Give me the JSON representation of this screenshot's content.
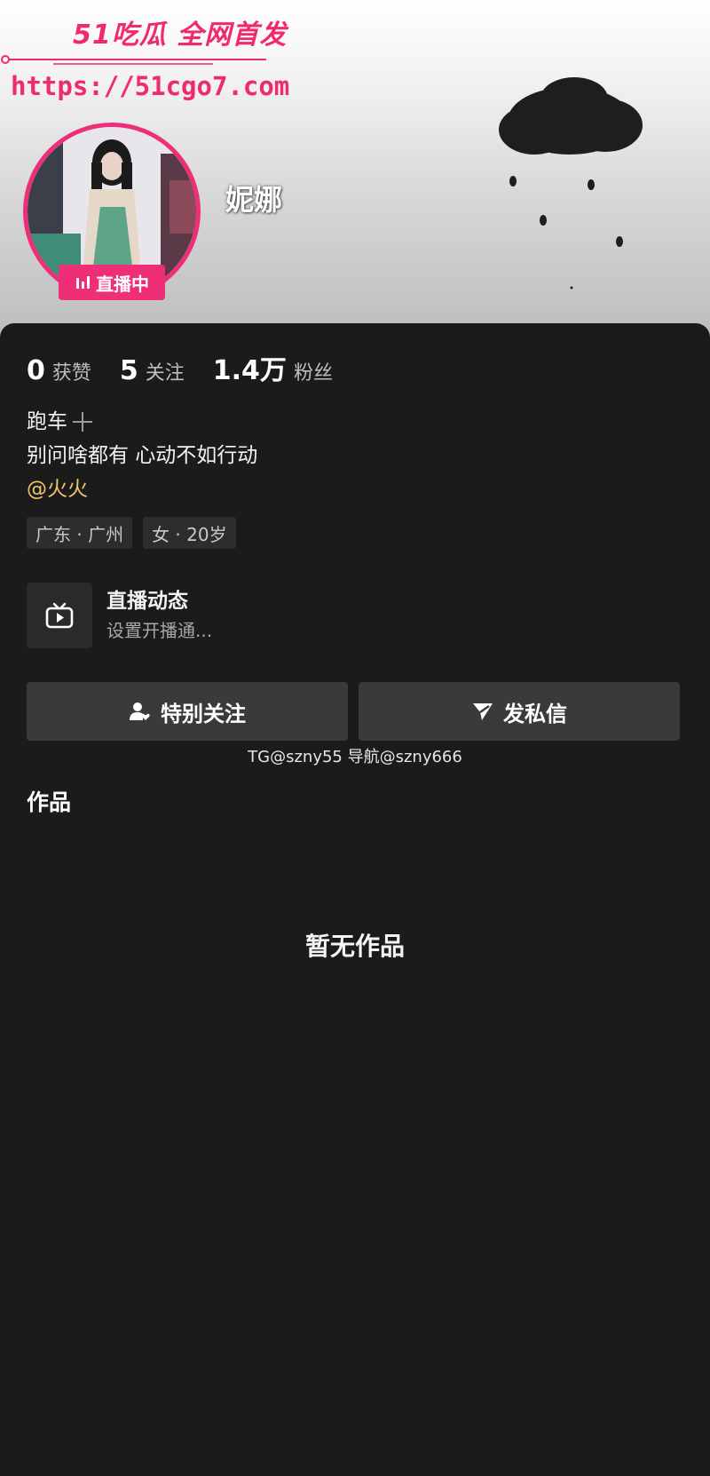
{
  "watermark": {
    "brand": "51吃瓜 全网首发",
    "url": "https://51cgo7.com"
  },
  "profile": {
    "live_badge": "直播中",
    "username": "妮娜"
  },
  "stats": [
    {
      "value": "0",
      "label": "获赞"
    },
    {
      "value": "5",
      "label": "关注"
    },
    {
      "value": "1.4万",
      "label": "粉丝"
    }
  ],
  "bio": {
    "line1": "跑车",
    "line2": "别问啥都有  心动不如行动",
    "mention": "@火火"
  },
  "tags": [
    "广东 · 广州",
    "女 · 20岁"
  ],
  "live_dynamic": {
    "title": "直播动态",
    "subtitle": "设置开播通..."
  },
  "buttons": {
    "follow": "特别关注",
    "message": "发私信"
  },
  "contact_line": "TG@szny55  导航@szny666",
  "works": {
    "title": "作品",
    "empty": "暂无作品"
  },
  "colors": {
    "accent": "#ee2f78",
    "mention": "#f2c46a",
    "background": "#1b1b1c"
  }
}
